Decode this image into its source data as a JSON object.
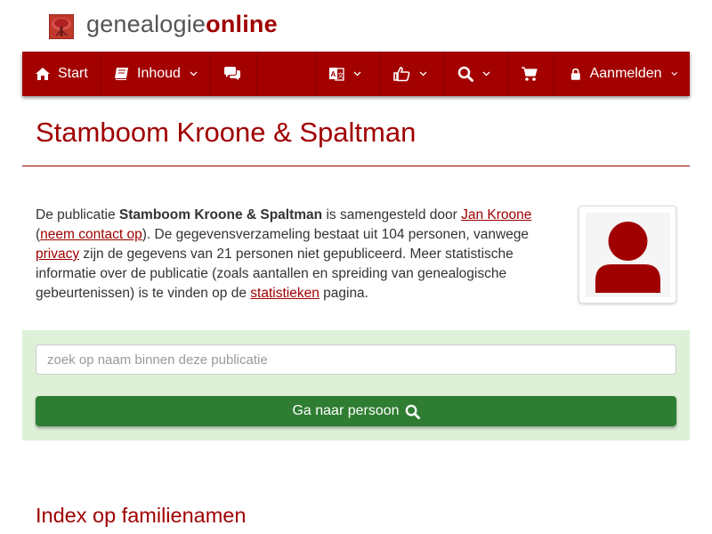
{
  "logo": {
    "part1": "genealogie",
    "part2": "online",
    "icon": "tree-icon"
  },
  "nav": {
    "start": {
      "label": "Start",
      "icon": "home-icon"
    },
    "inhoud": {
      "label": "Inhoud",
      "icon": "book-icon"
    },
    "chat": {
      "icon": "comments-icon"
    },
    "language": {
      "icon": "language-icon"
    },
    "social": {
      "icon": "thumbs-up-icon"
    },
    "search": {
      "icon": "search-icon"
    },
    "cart": {
      "icon": "cart-icon"
    },
    "login": {
      "label": "Aanmelden",
      "icon": "lock-icon"
    }
  },
  "page": {
    "title": "Stamboom Kroone & Spaltman"
  },
  "intro": {
    "t1": "De publicatie ",
    "pub": "Stamboom Kroone & Spaltman",
    "t2": " is samengesteld door ",
    "author": "Jan Kroone",
    "t3": " (",
    "contact": "neem contact op",
    "t4": "). De gegevensverzameling bestaat uit 104 personen, vanwege ",
    "privacy": "privacy",
    "t5": " zijn de gegevens van 21 personen niet gepubliceerd. Meer statistische informatie over de publicatie (zoals aantallen en spreiding van genealogische gebeurtenissen) is te vinden op de ",
    "stats": "statistieken",
    "t6": " pagina."
  },
  "search": {
    "placeholder": "zoek op naam binnen deze publicatie",
    "button": "Ga naar persoon",
    "button_icon": "search-icon"
  },
  "index": {
    "title": "Index op familienamen"
  },
  "colors": {
    "brand": "#a30000",
    "panel": "#dff0d8",
    "button": "#2e7d32"
  }
}
